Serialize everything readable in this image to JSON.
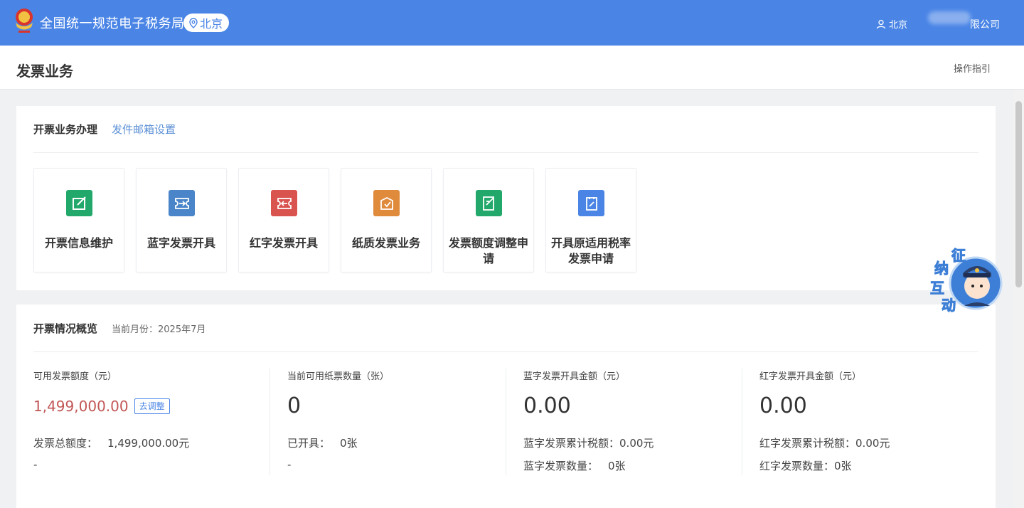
{
  "header": {
    "site_title": "全国统一规范电子税务局",
    "region": "北京",
    "user_region": "北京",
    "company_suffix": "限公司"
  },
  "page": {
    "title": "发票业务",
    "guide_link": "操作指引"
  },
  "business": {
    "title": "开票业务办理",
    "mail_link": "发件邮箱设置",
    "tiles": [
      {
        "label": "开票信息维护",
        "color": "#23a86b",
        "icon": "edit-icon"
      },
      {
        "label": "蓝字发票开具",
        "color": "#4a85c9",
        "icon": "invoice-in-icon"
      },
      {
        "label": "红字发票开具",
        "color": "#d9534f",
        "icon": "invoice-out-icon"
      },
      {
        "label": "纸质发票业务",
        "color": "#e08a3c",
        "icon": "paper-invoice-icon"
      },
      {
        "label": "发票额度调整申请",
        "color": "#23a86b",
        "icon": "quota-icon"
      },
      {
        "label": "开具原适用税率发票申请",
        "color": "#4a85e6",
        "icon": "clipboard-icon"
      }
    ]
  },
  "overview": {
    "title": "开票情况概览",
    "month_label": "当前月份：2025年7月",
    "stats": [
      {
        "label": "可用发票额度（元）",
        "value": "1,499,000.00",
        "button": "去调整",
        "line1_label": "发票总额度：",
        "line1_value": "1,499,000.00元",
        "line2": "-"
      },
      {
        "label": "当前可用纸票数量（张）",
        "value": "0",
        "line1_label": "已开具：",
        "line1_value": "0张",
        "line2": "-"
      },
      {
        "label": "蓝字发票开具金额（元）",
        "value": "0.00",
        "line1_label": "蓝字发票累计税额：",
        "line1_value": "0.00元",
        "line2_label": "蓝字发票数量：",
        "line2_value": "0张"
      },
      {
        "label": "红字发票开具金额（元）",
        "value": "0.00",
        "line1_label": "红字发票累计税额：",
        "line1_value": "0.00元",
        "line2_label": "红字发票数量：",
        "line2_value": "0张"
      }
    ]
  },
  "mascot": {
    "text": [
      "征",
      "纳",
      "互",
      "动"
    ]
  }
}
